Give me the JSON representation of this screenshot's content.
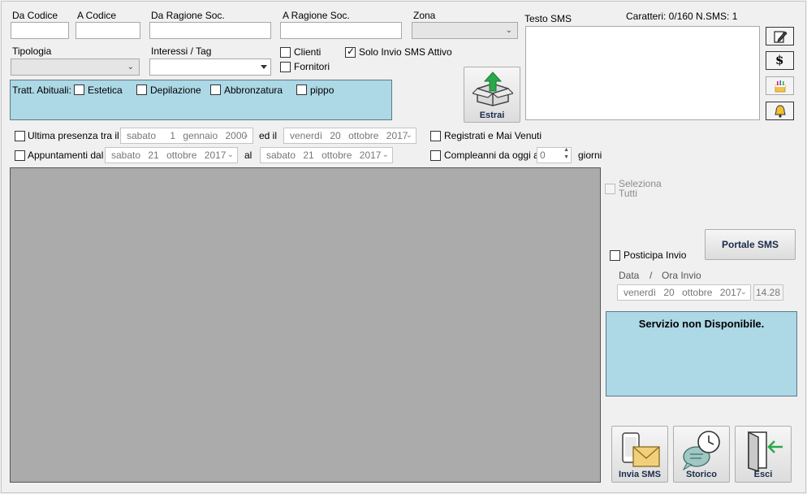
{
  "filters": {
    "da_codice_label": "Da Codice",
    "a_codice_label": "A Codice",
    "da_ragione_label": "Da Ragione Soc.",
    "a_ragione_label": "A Ragione Soc.",
    "zona_label": "Zona",
    "tipologia_label": "Tipologia",
    "interessi_label": "Interessi / Tag",
    "clienti_label": "Clienti",
    "fornitori_label": "Fornitori",
    "solo_sms_label": "Solo Invio SMS Attivo",
    "clienti_checked": false,
    "fornitori_checked": false,
    "solo_sms_checked": true
  },
  "trattamenti": {
    "label": "Tratt. Abituali:",
    "items": [
      "Estetica",
      "Depilazione",
      "Abbronzatura",
      "pippo"
    ]
  },
  "estrai_label": "Estrai",
  "sms": {
    "label": "Testo SMS",
    "counter": "Caratteri: 0/160  N.SMS: 1"
  },
  "dates": {
    "ultima_presenza_label": "Ultima presenza tra il",
    "ultima_from": {
      "day": "sabato",
      "num": "1",
      "month": "gennaio",
      "year": "2000"
    },
    "ed_il_label": "ed il",
    "ultima_to": {
      "day": "venerdì",
      "num": "20",
      "month": "ottobre",
      "year": "2017"
    },
    "appuntamenti_label": "Appuntamenti dal",
    "app_from": {
      "day": "sabato",
      "num": "21",
      "month": "ottobre",
      "year": "2017"
    },
    "al_label": "al",
    "app_to": {
      "day": "sabato",
      "num": "21",
      "month": "ottobre",
      "year": "2017"
    },
    "registrati_label": "Registrati e Mai Venuti",
    "compleanni_label": "Compleanni da oggi a",
    "compleanni_value": "0",
    "giorni_label": "giorni"
  },
  "right": {
    "seleziona_line1": "Seleziona",
    "seleziona_line2": "Tutti",
    "portale_label": "Portale SMS",
    "posticipa_label": "Posticipa Invio",
    "data_label": "Data",
    "slash": "/",
    "ora_label": "Ora Invio",
    "send_date": {
      "day": "venerdì",
      "num": "20",
      "month": "ottobre",
      "year": "2017"
    },
    "send_time": "14.28",
    "status_text": "Servizio non Disponibile."
  },
  "actions": {
    "invia_label": "Invia SMS",
    "storico_label": "Storico",
    "esci_label": "Esci"
  },
  "icons": {
    "edit": "edit-note-icon",
    "dollar": "dollar-icon",
    "cake": "birthday-cake-icon",
    "bell": "bell-icon"
  }
}
